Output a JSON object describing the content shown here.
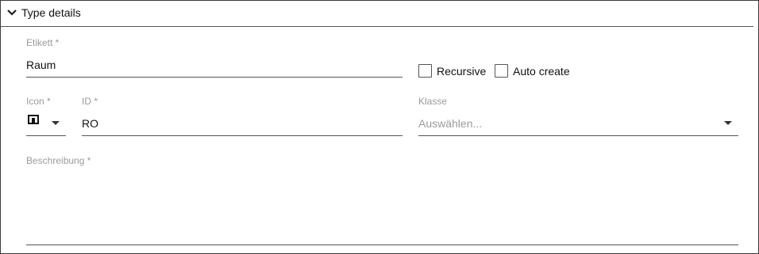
{
  "panel": {
    "title": "Type details",
    "icons": {
      "collapse": "chevron-down-icon",
      "icon_preview": "square-icon",
      "dropdown": "caret-down-icon"
    }
  },
  "fields": {
    "label": {
      "label": "Etikett *",
      "value": "Raum"
    },
    "recursive": {
      "label": "Recursive",
      "checked": false
    },
    "auto_create": {
      "label": "Auto create",
      "checked": false
    },
    "icon": {
      "label": "Icon *"
    },
    "id": {
      "label": "ID *",
      "value": "RO"
    },
    "class": {
      "label": "Klasse",
      "placeholder": "Auswählen..."
    },
    "description": {
      "label": "Beschreibung *",
      "value": ""
    }
  },
  "colors": {
    "label_gray": "#9a9a9a",
    "border": "#555555"
  }
}
